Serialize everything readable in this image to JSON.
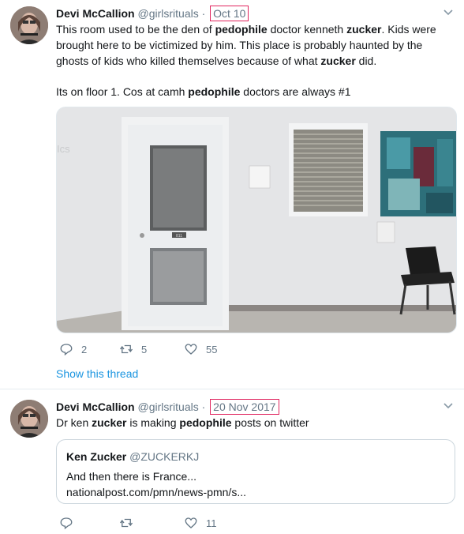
{
  "colors": {
    "accent": "#1b95e0",
    "highlight_box": "#e0245e",
    "muted": "#657786"
  },
  "tweets": [
    {
      "name": "Devi McCallion",
      "handle": "@girlsrituals",
      "separator": "·",
      "date": "Oct 10",
      "paragraph1": {
        "s1": "This room used to be the den of ",
        "k1": "pedophile",
        "s2": " doctor kenneth ",
        "k2": "zucker",
        "s3": ". Kids were brought here to be victimized by him. This place is probably haunted by the ghosts of kids who killed themselves because of what ",
        "k3": "zucker",
        "s4": " did."
      },
      "paragraph2": {
        "s1": "Its on floor 1. Cos at camh ",
        "k1": "pedophile",
        "s2": " doctors are always #1"
      },
      "photo": {
        "door_number": "811",
        "sign_text": "Ics"
      },
      "actions": {
        "replies": "2",
        "retweets": "5",
        "likes": "55"
      },
      "show_thread": "Show this thread"
    },
    {
      "name": "Devi McCallion",
      "handle": "@girlsrituals",
      "separator": "·",
      "date": "20 Nov 2017",
      "paragraph1": {
        "s1": "Dr ken ",
        "k1": "zucker",
        "s2": " is making ",
        "k2": "pedophile",
        "s3": " posts on twitter"
      },
      "quote": {
        "name": "Ken Zucker",
        "handle": "@ZUCKERKJ",
        "line1": "And then there is France...",
        "line2": "nationalpost.com/pmn/news-pmn/s..."
      },
      "actions": {
        "replies": "",
        "retweets": "",
        "likes": "11"
      }
    }
  ]
}
